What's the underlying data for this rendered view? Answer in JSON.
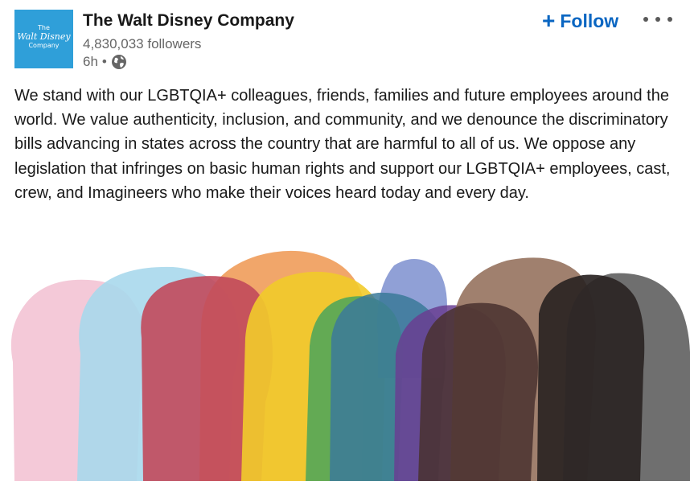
{
  "author": {
    "logo_lines": [
      "The",
      "Walt Disney",
      "Company"
    ],
    "name": "The Walt Disney Company",
    "followers": "4,830,033 followers",
    "time": "6h",
    "separator": "•",
    "visibility_icon": "globe-icon"
  },
  "actions": {
    "follow_plus": "+",
    "follow_label": "Follow",
    "more_icon": "more-horizontal-icon"
  },
  "post": {
    "text": "We stand with our LGBTQIA+ colleagues, friends, families and future employees around the world. We value authenticity, inclusion, and community, and we denounce the discriminatory bills advancing in states across the country that are harmful to all of us. We oppose any legislation that infringes on basic human rights and support our LGBTQIA+ employees, cast, crew, and Imagineers who make their voices heard today and every day."
  },
  "image": {
    "subject": "rainbow silhouettes of heads in profile",
    "colors": [
      "#f3c6d6",
      "#a9d8ec",
      "#c24a5c",
      "#ee9650",
      "#f2cb2b",
      "#4aa65c",
      "#7c8fcf",
      "#3b7a9a",
      "#6a3f93",
      "#8f6a55",
      "#4a3330",
      "#2a2423",
      "#5f5f5f"
    ]
  }
}
